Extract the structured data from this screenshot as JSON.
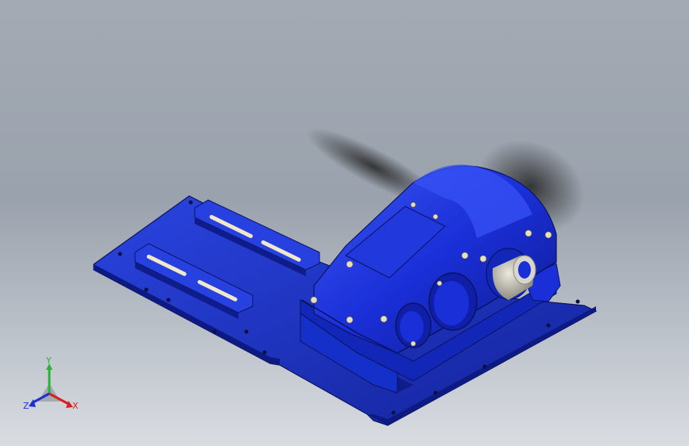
{
  "viewport": {
    "background_top": "#a3aab3",
    "background_bottom": "#d9dde2"
  },
  "model": {
    "base_plate_color": "#1f34c8",
    "gearbox_color": "#1a2fd8",
    "shaft_color": "#c8c6b8",
    "shadow_color": "#2c2c2c"
  },
  "triad": {
    "y_label": "Y",
    "z_label": "Z",
    "x_label": "X",
    "y_color": "#2bb03a",
    "x_color": "#d42020",
    "z_color": "#2030d0"
  }
}
